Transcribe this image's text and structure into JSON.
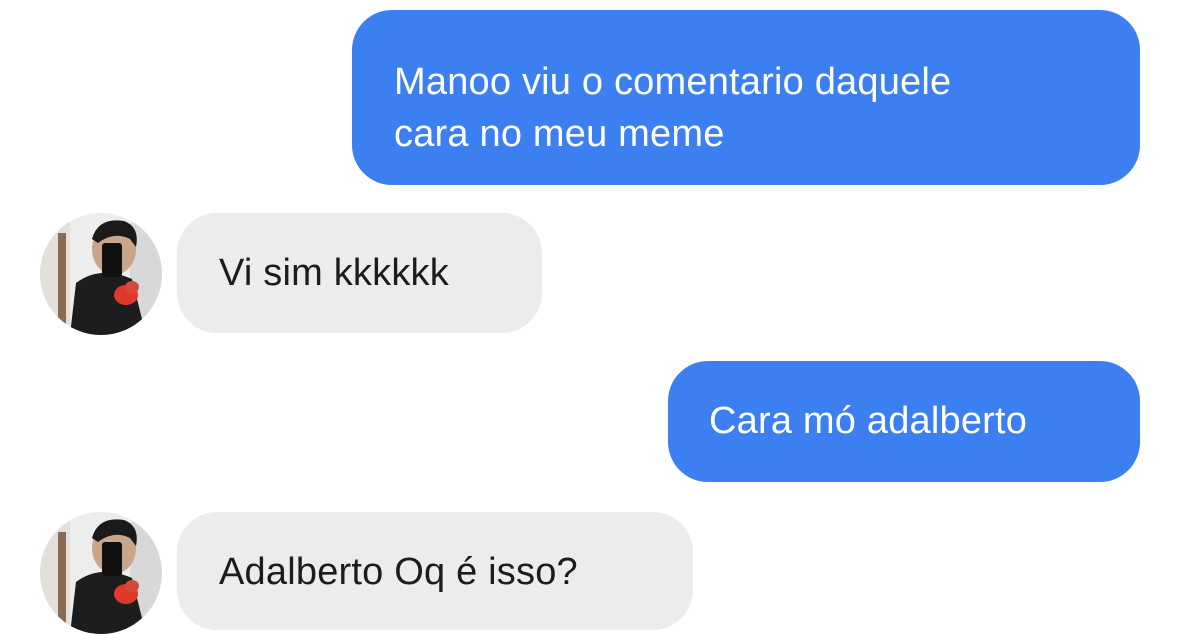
{
  "conversation": {
    "messages": [
      {
        "direction": "outgoing",
        "lines": [
          "Manoo viu o comentario daquele",
          "cara no meu meme"
        ]
      },
      {
        "direction": "incoming",
        "lines": [
          "Vi sim kkkkkk"
        ]
      },
      {
        "direction": "outgoing",
        "lines": [
          "Cara mó adalberto"
        ]
      },
      {
        "direction": "incoming",
        "lines": [
          "Adalberto Oq é isso?"
        ]
      }
    ]
  },
  "colors": {
    "outgoing_bubble": "#3b7ff0",
    "incoming_bubble": "#ececec",
    "outgoing_text": "#ffffff",
    "incoming_text": "#1c1c1c",
    "background": "#ffffff"
  },
  "icons": {
    "contact_avatar": "profile-photo"
  }
}
